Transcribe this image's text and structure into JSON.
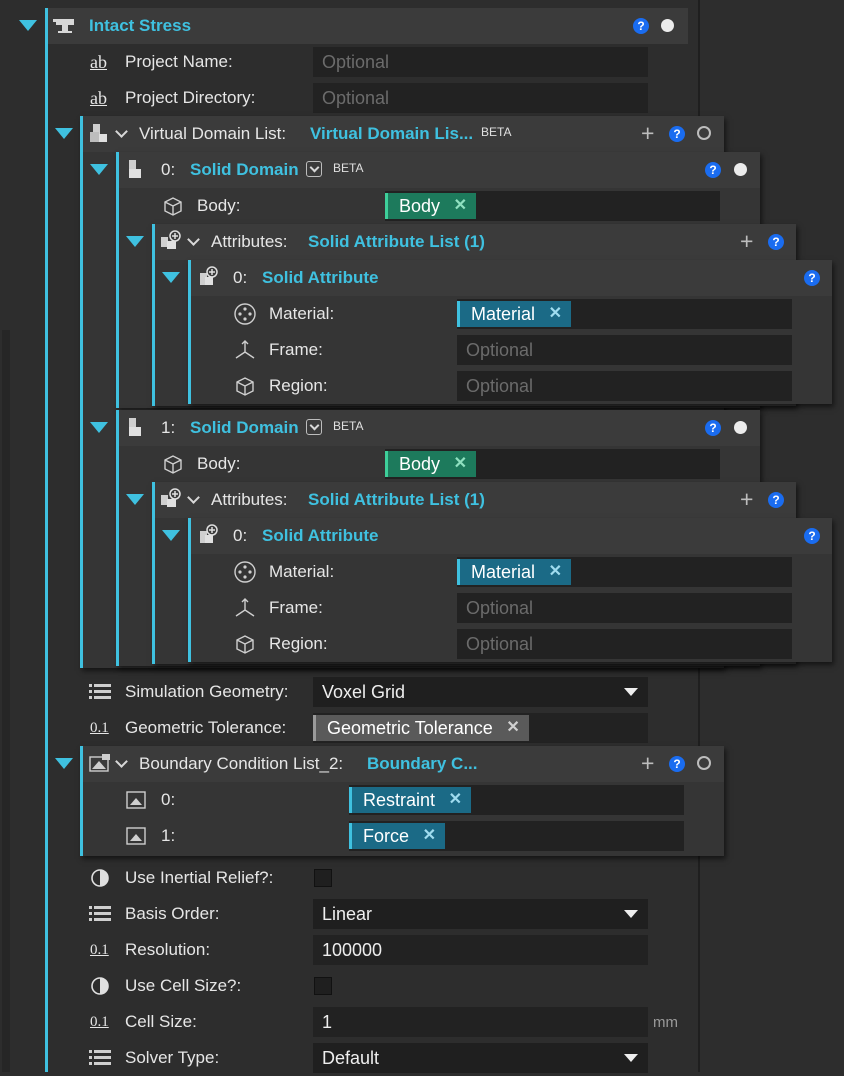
{
  "root": {
    "title": "Intact Stress"
  },
  "project": {
    "name_label": "Project Name:",
    "name_placeholder": "Optional",
    "dir_label": "Project Directory:",
    "dir_placeholder": "Optional"
  },
  "vdl": {
    "label": "Virtual Domain List:",
    "title": "Virtual Domain Lis...",
    "badge": "BETA"
  },
  "domains": [
    {
      "index": "0:",
      "title": "Solid Domain",
      "badge": "BETA",
      "body_label": "Body:",
      "body_value": "Body",
      "attr_label": "Attributes:",
      "attr_title": "Solid Attribute List (1)",
      "attr_index": "0:",
      "attr_item": "Solid Attribute",
      "material_label": "Material:",
      "material_value": "Material",
      "frame_label": "Frame:",
      "frame_placeholder": "Optional",
      "region_label": "Region:",
      "region_placeholder": "Optional"
    },
    {
      "index": "1:",
      "title": "Solid Domain",
      "badge": "BETA",
      "body_label": "Body:",
      "body_value": "Body",
      "attr_label": "Attributes:",
      "attr_title": "Solid Attribute List (1)",
      "attr_index": "0:",
      "attr_item": "Solid Attribute",
      "material_label": "Material:",
      "material_value": "Material",
      "frame_label": "Frame:",
      "frame_placeholder": "Optional",
      "region_label": "Region:",
      "region_placeholder": "Optional"
    }
  ],
  "sim_geom": {
    "label": "Simulation Geometry:",
    "value": "Voxel Grid"
  },
  "geo_tol": {
    "label": "Geometric Tolerance:",
    "value": "Geometric Tolerance"
  },
  "bcl": {
    "label": "Boundary Condition List_2:",
    "title": "Boundary C...",
    "items": [
      {
        "index": "0:",
        "value": "Restraint"
      },
      {
        "index": "1:",
        "value": "Force"
      }
    ]
  },
  "inertial": {
    "label": "Use Inertial Relief?:"
  },
  "basis": {
    "label": "Basis Order:",
    "value": "Linear"
  },
  "resolution": {
    "label": "Resolution:",
    "value": "100000"
  },
  "cell_size_toggle": {
    "label": "Use Cell Size?:"
  },
  "cell_size": {
    "label": "Cell Size:",
    "value": "1",
    "unit": "mm"
  },
  "solver": {
    "label": "Solver Type:",
    "value": "Default"
  },
  "icons": {
    "text": "ab",
    "number": "0.1",
    "help": "?",
    "remove": "✕",
    "add": "+"
  },
  "colors": {
    "accent": "#3fc1e0",
    "chip_green": "#1d7a5c",
    "chip_teal": "#1b6a86",
    "help": "#1a6cf0"
  }
}
